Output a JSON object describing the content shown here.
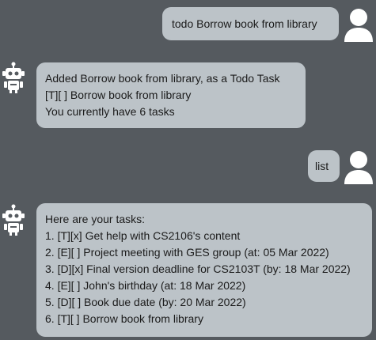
{
  "messages": [
    {
      "sender": "user",
      "avatar_icon": "user-icon",
      "lines": [
        "todo Borrow book from library"
      ]
    },
    {
      "sender": "bot",
      "avatar_icon": "robot-icon",
      "lines": [
        "Added Borrow book from library, as a Todo Task",
        "[T][ ] Borrow book from library",
        "You currently have 6 tasks"
      ]
    },
    {
      "sender": "user",
      "avatar_icon": "user-icon",
      "lines": [
        "list"
      ]
    },
    {
      "sender": "bot",
      "avatar_icon": "robot-icon",
      "lines": [
        "Here are your tasks:",
        "1. [T][x] Get help with CS2106's content",
        "2. [E][ ] Project meeting with GES group (at: 05 Mar 2022)",
        "3. [D][x] Final version deadline for CS2103T (by: 18 Mar 2022)",
        "4. [E][ ] John's birthday (at: 18 Mar 2022)",
        "5. [D][ ] Book due date (by: 20 Mar 2022)",
        "6. [T][ ] Borrow book from library"
      ]
    }
  ],
  "colors": {
    "background": "#555a5f",
    "bubble": "#bcc3c8",
    "text": "#1b1b1b",
    "avatar": "#ffffff"
  }
}
